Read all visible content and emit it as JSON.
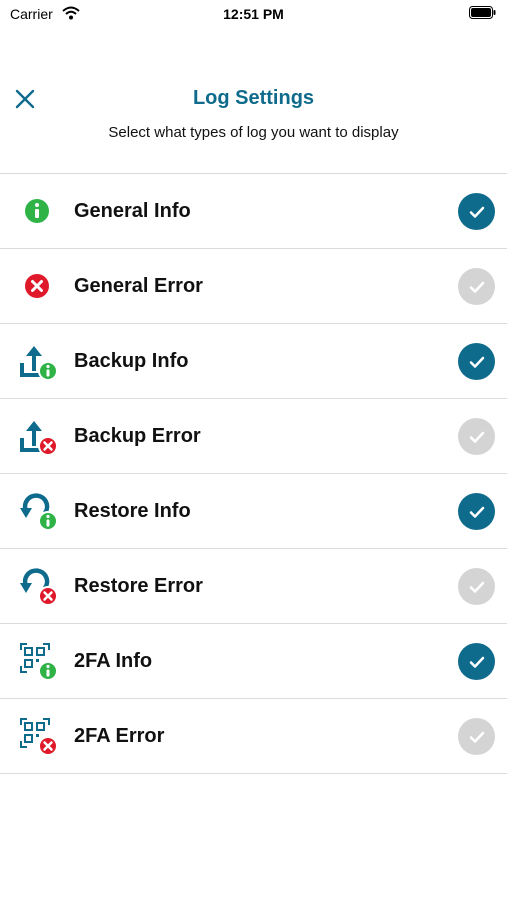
{
  "status_bar": {
    "carrier": "Carrier",
    "time": "12:51 PM"
  },
  "header": {
    "title": "Log Settings",
    "subtitle": "Select what types of log you want to display"
  },
  "colors": {
    "accent": "#0f6b8c",
    "info_green": "#2fb347",
    "error_red": "#e0192a",
    "unchecked": "#d4d4d4"
  },
  "items": [
    {
      "label": "General Info",
      "icon": "info-circle-icon",
      "checked": true
    },
    {
      "label": "General Error",
      "icon": "error-circle-icon",
      "checked": false
    },
    {
      "label": "Backup Info",
      "icon": "backup-info-icon",
      "checked": true
    },
    {
      "label": "Backup Error",
      "icon": "backup-error-icon",
      "checked": false
    },
    {
      "label": "Restore Info",
      "icon": "restore-info-icon",
      "checked": true
    },
    {
      "label": "Restore Error",
      "icon": "restore-error-icon",
      "checked": false
    },
    {
      "label": "2FA Info",
      "icon": "qr-info-icon",
      "checked": true
    },
    {
      "label": "2FA Error",
      "icon": "qr-error-icon",
      "checked": false
    }
  ]
}
